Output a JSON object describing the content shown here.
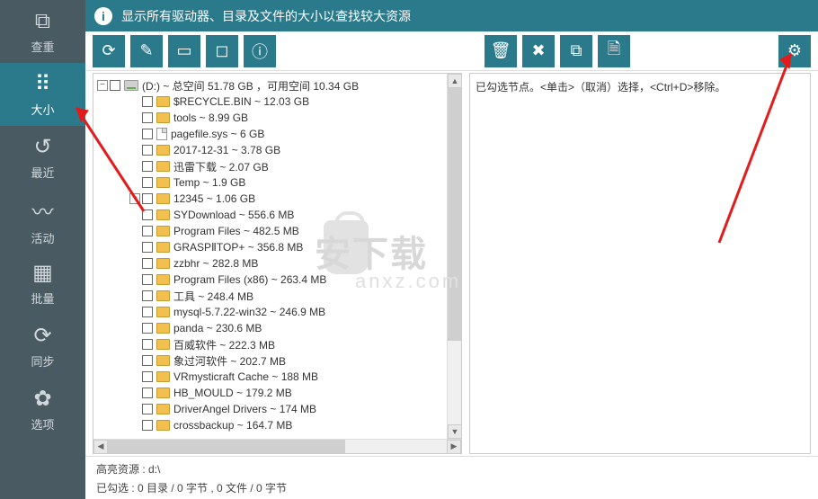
{
  "banner": {
    "text": "显示所有驱动器、目录及文件的大小以查找较大资源"
  },
  "sidebar": [
    {
      "label": "查重",
      "icon": "⧉"
    },
    {
      "label": "大小",
      "icon": "⠿",
      "active": true
    },
    {
      "label": "最近",
      "icon": "↺"
    },
    {
      "label": "活动",
      "icon": "〰"
    },
    {
      "label": "批量",
      "icon": "▦"
    },
    {
      "label": "同步",
      "icon": "⟳"
    },
    {
      "label": "选项",
      "icon": "✿"
    }
  ],
  "toolbar": {
    "left": [
      "refresh",
      "edit",
      "open",
      "fullscreen",
      "info"
    ],
    "mid": [
      "recycle",
      "close",
      "copy",
      "file"
    ],
    "right": [
      "settings"
    ]
  },
  "toolbar_glyphs": {
    "refresh": "⟳",
    "edit": "✎",
    "open": "▭",
    "fullscreen": "◻",
    "info": "ⓘ",
    "recycle": "🗑",
    "close": "✖",
    "copy": "⧉",
    "file": "🗎",
    "settings": "⚙"
  },
  "drive": {
    "label": "(D:) ~ 总空间 51.78 GB ，可用空间 10.34 GB"
  },
  "tree": [
    {
      "type": "folder",
      "label": "$RECYCLE.BIN ~ 12.03 GB"
    },
    {
      "type": "folder",
      "label": "tools ~ 8.99 GB"
    },
    {
      "type": "file",
      "label": "pagefile.sys ~ 6 GB"
    },
    {
      "type": "folder",
      "label": "2017-12-31 ~ 3.78 GB"
    },
    {
      "type": "folder",
      "label": "迅雷下载 ~ 2.07 GB"
    },
    {
      "type": "folder",
      "label": "Temp ~ 1.9 GB"
    },
    {
      "type": "folder",
      "label": "12345 ~ 1.06 GB",
      "expandable": true
    },
    {
      "type": "folder",
      "label": "SYDownload ~ 556.6 MB"
    },
    {
      "type": "folder",
      "label": "Program Files ~ 482.5 MB"
    },
    {
      "type": "folder",
      "label": "GRASPⅡTOP+ ~ 356.8 MB"
    },
    {
      "type": "folder",
      "label": "zzbhr ~ 282.8 MB"
    },
    {
      "type": "folder",
      "label": "Program Files (x86) ~ 263.4 MB"
    },
    {
      "type": "folder",
      "label": "工具 ~ 248.4 MB"
    },
    {
      "type": "folder",
      "label": "mysql-5.7.22-win32 ~ 246.9 MB"
    },
    {
      "type": "folder",
      "label": "panda ~ 230.6 MB"
    },
    {
      "type": "folder",
      "label": "百威软件 ~ 222.3 MB"
    },
    {
      "type": "folder",
      "label": "象过河软件 ~ 202.7 MB"
    },
    {
      "type": "folder",
      "label": "VRmysticraft Cache ~ 188 MB"
    },
    {
      "type": "folder",
      "label": "HB_MOULD ~ 179.2 MB"
    },
    {
      "type": "folder",
      "label": "DriverAngel Drivers ~ 174 MB"
    },
    {
      "type": "folder",
      "label": "crossbackup ~ 164.7 MB"
    }
  ],
  "right_panel": {
    "text": "已勾选节点。<单击>（取消）选择，<Ctrl+D>移除。"
  },
  "status": {
    "line1": "高亮资源 : d:\\",
    "line2": "已勾选 : 0 目录 / 0 字节 , 0 文件 / 0  字节"
  },
  "watermark": {
    "main": "安下载",
    "sub": "anxz.com"
  }
}
